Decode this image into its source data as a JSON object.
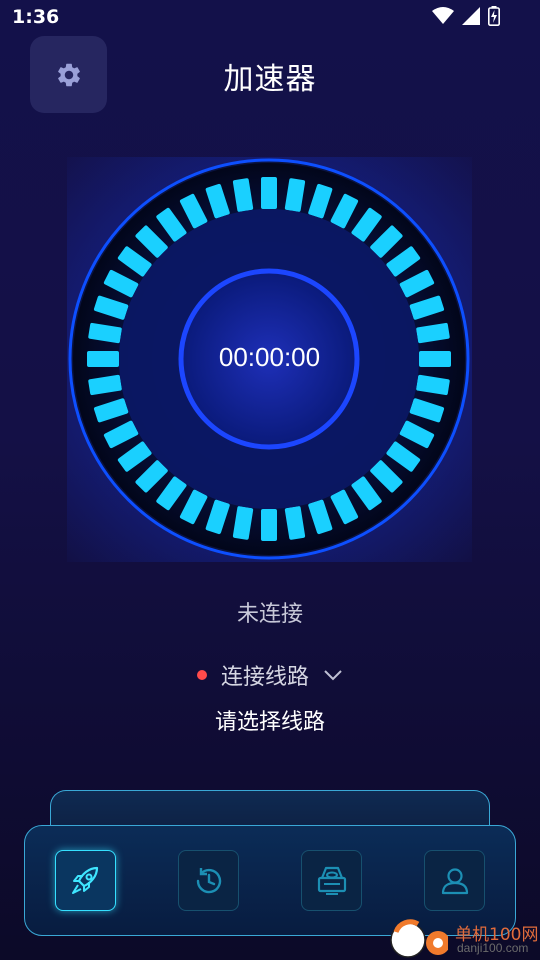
{
  "status_bar": {
    "time": "1:36",
    "icons": [
      "wifi-icon",
      "signal-icon",
      "battery-charging-icon"
    ]
  },
  "header": {
    "title": "加速器",
    "settings_icon": "gear-icon"
  },
  "dial": {
    "timer": "00:00:00",
    "accent_color": "#1ad0ff"
  },
  "connection": {
    "status": "未连接",
    "route_label": "连接线路",
    "route_placeholder": "请选择线路",
    "status_dot_color": "#ff4b4b"
  },
  "bottom_nav": {
    "items": [
      {
        "icon": "rocket-icon",
        "active": true
      },
      {
        "icon": "history-icon",
        "active": false
      },
      {
        "icon": "server-icon",
        "active": false
      },
      {
        "icon": "user-icon",
        "active": false
      }
    ]
  },
  "watermark": {
    "title": "单机100网",
    "url": "danji100.com"
  }
}
